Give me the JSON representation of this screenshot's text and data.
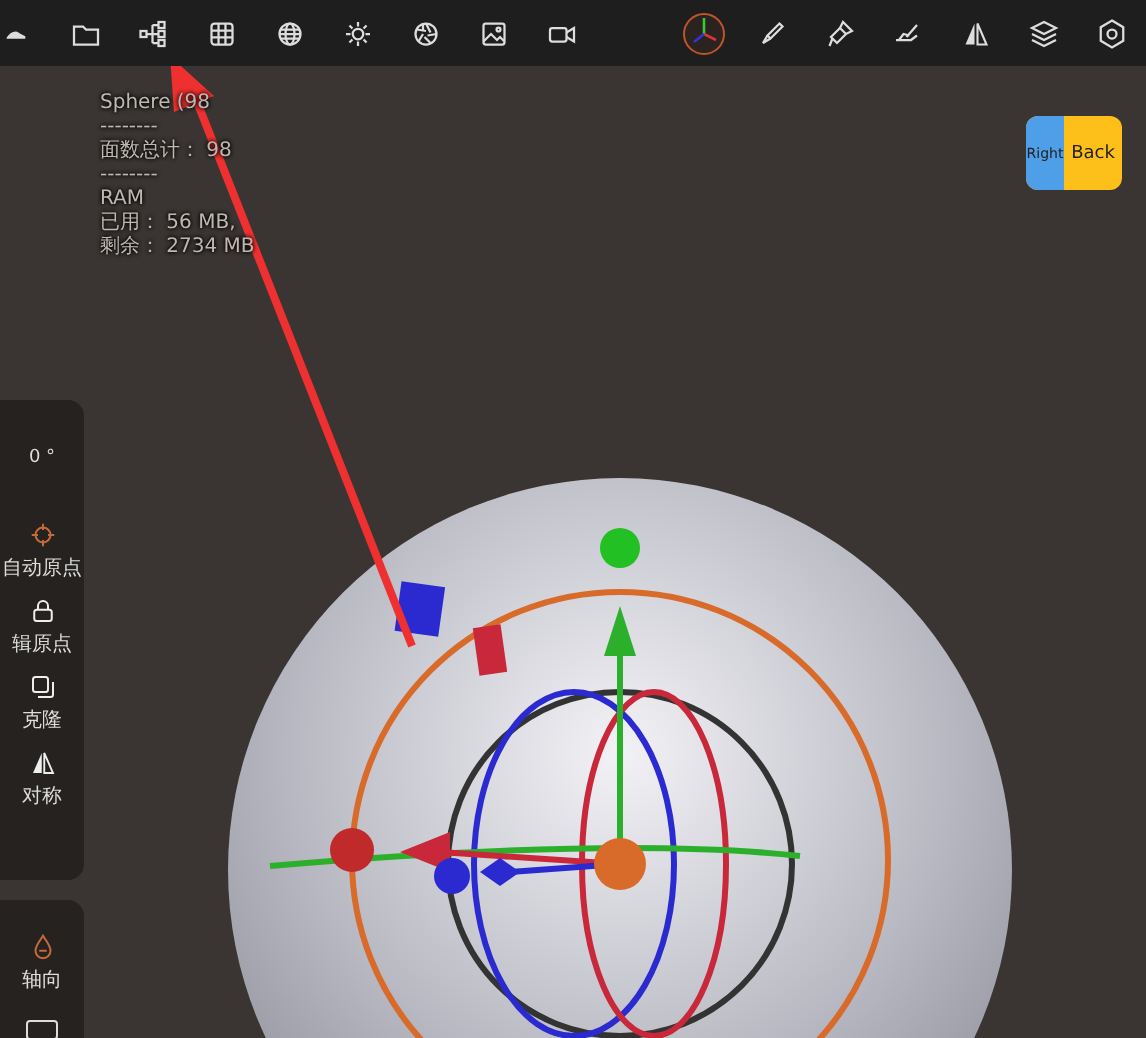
{
  "stats": [
    "Sphere (98",
    "--------",
    "面数总计： 98",
    "--------",
    "RAM",
    "已用： 56 MB,",
    "剩余： 2734 MB"
  ],
  "angle": "0 °",
  "left_panel": [
    {
      "kind": "target",
      "label": "自动原点"
    },
    {
      "kind": "lock",
      "label": "辑原点"
    },
    {
      "kind": "clone",
      "label": "克隆"
    },
    {
      "kind": "mirror",
      "label": "对称"
    }
  ],
  "left_panel_2": [
    {
      "kind": "drop",
      "label": "轴向"
    }
  ],
  "view_cube": {
    "left": "Right",
    "right": "Back"
  }
}
